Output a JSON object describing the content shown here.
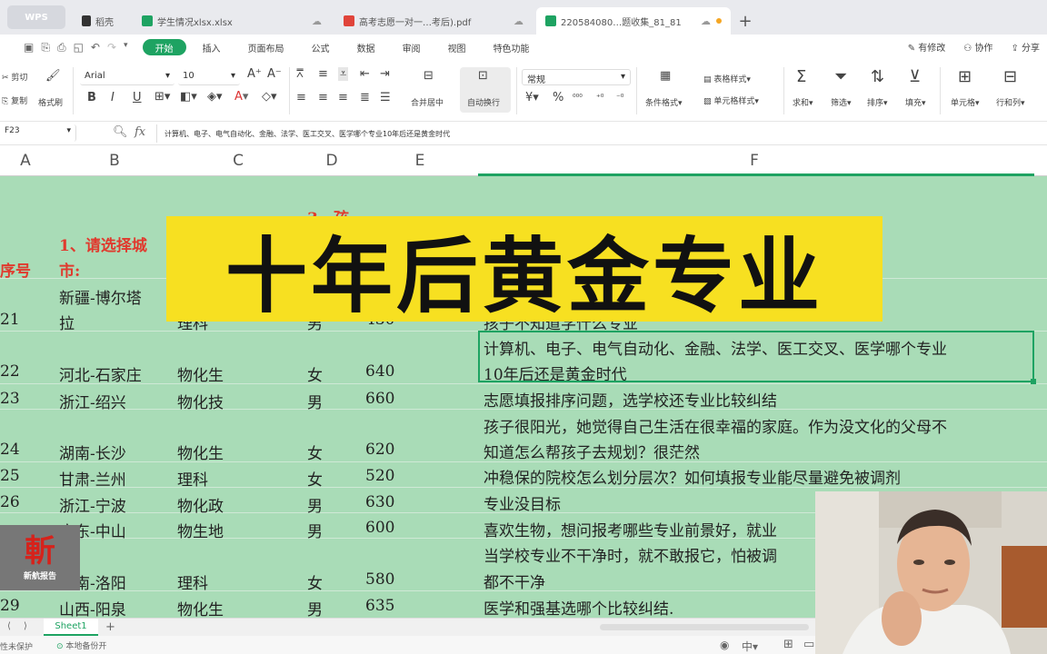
{
  "tabs": [
    {
      "label": "WPS"
    },
    {
      "label": "稻壳"
    },
    {
      "label": "学生情况xlsx.xlsx"
    },
    {
      "label": "高考志愿一对一…考后).pdf"
    },
    {
      "label": "220584080…题收集_81_81"
    }
  ],
  "menu": {
    "items": [
      "开始",
      "插入",
      "页面布局",
      "公式",
      "数据",
      "审阅",
      "视图",
      "特色功能"
    ],
    "right": [
      "有修改",
      "协作",
      "分享"
    ]
  },
  "ribbon": {
    "cut": "剪切",
    "copy": "复制",
    "format_painter": "格式刷",
    "font": "Arial",
    "size": "10",
    "merge": "合并居中",
    "wrap": "自动换行",
    "number_format": "常规",
    "cond_format": "条件格式",
    "table_style": "表格样式",
    "cell_style": "单元格样式",
    "sum": "求和",
    "filter": "筛选",
    "sort": "排序",
    "fill": "填充",
    "cell": "单元格",
    "rowcol": "行和列"
  },
  "formula": {
    "cell_ref": "F23",
    "fx": "fx",
    "content": "计算机、电子、电气自动化、金融、法学、医工交叉、医学哪个专业10年后还是黄金时代"
  },
  "columns": [
    "A",
    "B",
    "C",
    "D",
    "E",
    "F"
  ],
  "header": {
    "seq": "序号",
    "city_1": "1、请选择城",
    "city_2": "市:",
    "q3": "3、孩"
  },
  "rows": [
    {
      "no": "21",
      "city_1": "新疆-博尔塔",
      "city_2": "拉",
      "subj": "理科",
      "sex": "男",
      "score": "430",
      "q": "孩子不知道学什么专业"
    },
    {
      "no": "22",
      "city": "河北-石家庄",
      "subj": "物化生",
      "sex": "女",
      "score": "640",
      "q_1": "计算机、电子、电气自动化、金融、法学、医工交叉、医学哪个专业",
      "q_2": "10年后还是黄金时代"
    },
    {
      "no": "23",
      "city": "浙江-绍兴",
      "subj": "物化技",
      "sex": "男",
      "score": "660",
      "q": "志愿填报排序问题，选学校还专业比较纠结"
    },
    {
      "no": "24",
      "city": "湖南-长沙",
      "subj": "物化生",
      "sex": "女",
      "score": "620",
      "q_1": "孩子很阳光，她觉得自己生活在很幸福的家庭。作为没文化的父母不",
      "q_2": "知道怎么帮孩子去规划？很茫然"
    },
    {
      "no": "25",
      "city": "甘肃-兰州",
      "subj": "理科",
      "sex": "女",
      "score": "520",
      "q": "冲稳保的院校怎么划分层次？如何填报专业能尽量避免被调剂"
    },
    {
      "no": "26",
      "city": "浙江-宁波",
      "subj": "物化政",
      "sex": "男",
      "score": "630",
      "q": "专业没目标"
    },
    {
      "city": "广东-中山",
      "subj": "物生地",
      "sex": "男",
      "score": "600",
      "q": "喜欢生物，想问报考哪些专业前景好，就业"
    },
    {
      "city": "河南-洛阳",
      "subj": "理科",
      "sex": "女",
      "score": "580",
      "q_1": "当学校专业不干净时，就不敢报它，怕被调",
      "q_2": "都不干净"
    },
    {
      "no": "29",
      "city": "山西-阳泉",
      "subj": "物化生",
      "sex": "男",
      "score": "635",
      "q": "医学和强基选哪个比较纠结."
    }
  ],
  "banner": "十年后黄金专业",
  "logo_text": "新航报告",
  "sheet_tab": "Sheet1",
  "status": {
    "protect": "性未保护",
    "backup": "本地备份开"
  }
}
